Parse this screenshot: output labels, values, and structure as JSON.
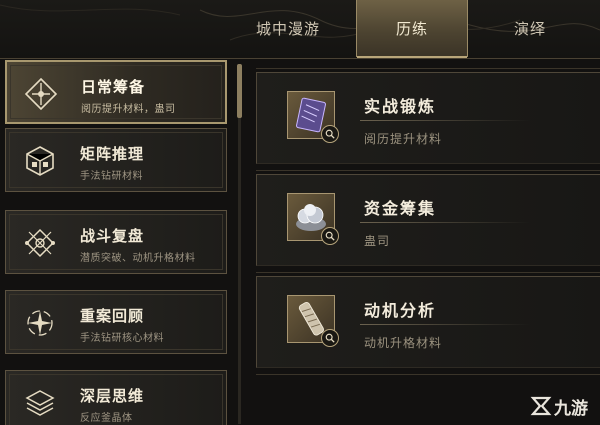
{
  "top_tabs": [
    {
      "label": "城中漫游",
      "active": false
    },
    {
      "label": "历练",
      "active": true
    },
    {
      "label": "演绎",
      "active": false
    }
  ],
  "left_list": [
    {
      "title": "日常筹备",
      "subtitle": "阅历提升材料，蛊司",
      "icon": "compass-diamond-icon",
      "active": true
    },
    {
      "title": "矩阵推理",
      "subtitle": "手法钻研材料",
      "icon": "cube-matrix-icon",
      "active": false
    },
    {
      "title": "战斗复盘",
      "subtitle": "潜质突破、动机升格材料",
      "icon": "crossed-diamond-icon",
      "active": false
    },
    {
      "title": "重案回顾",
      "subtitle": "手法钻研核心材料",
      "icon": "spiral-star-icon",
      "active": false
    },
    {
      "title": "深层思维",
      "subtitle": "反应釜晶体",
      "icon": "layered-stack-icon",
      "active": false
    }
  ],
  "right_list": [
    {
      "title": "实战锻炼",
      "subtitle": "阅历提升材料",
      "icon": "purple-book-icon"
    },
    {
      "title": "资金筹集",
      "subtitle": "蛊司",
      "icon": "silver-coin-pile-icon"
    },
    {
      "title": "动机分析",
      "subtitle": "动机升格材料",
      "icon": "ornate-scroll-icon"
    }
  ],
  "watermark": {
    "text": "九游"
  },
  "colors": {
    "accent_gold": "#a8986f",
    "background": "#121110"
  }
}
